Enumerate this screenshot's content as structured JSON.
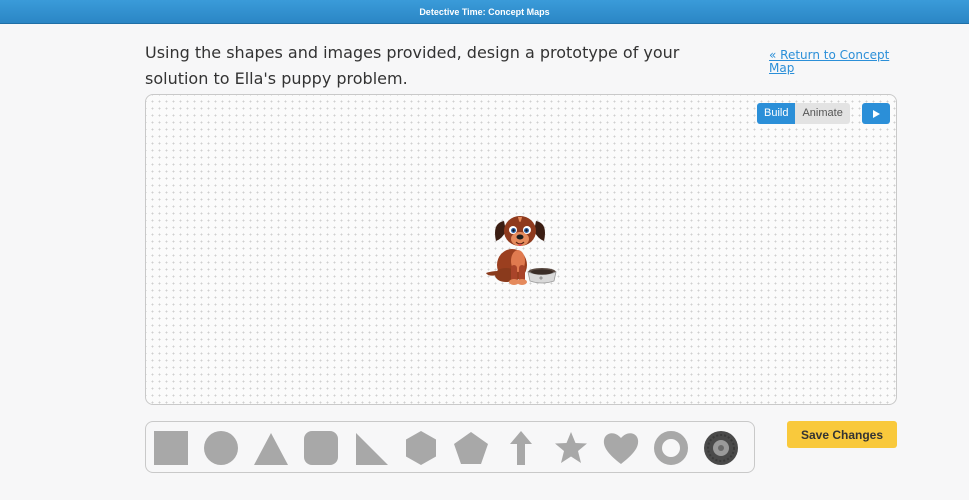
{
  "header": {
    "title": "Detective Time: Concept Maps"
  },
  "instructions": {
    "text": "Using the shapes and images provided, design a prototype of your solution to Ella's puppy problem."
  },
  "navigation": {
    "return_link": "« Return to Concept Map"
  },
  "toolbar": {
    "build_label": "Build",
    "animate_label": "Animate",
    "active_mode": "Build",
    "play_icon": "play-icon"
  },
  "canvas": {
    "items": [
      {
        "type": "image",
        "icon": "puppy-with-bowl"
      }
    ]
  },
  "palette": {
    "shapes": [
      "square",
      "circle",
      "triangle",
      "rounded-square",
      "right-triangle",
      "hexagon",
      "pentagon",
      "arrow-up",
      "star",
      "heart",
      "ring",
      "tire"
    ]
  },
  "actions": {
    "save_label": "Save Changes"
  },
  "colors": {
    "header_blue": "#2b86c5",
    "accent_blue": "#2b8fd8",
    "save_yellow": "#f9c93c",
    "shape_gray": "#a8a8a8"
  }
}
